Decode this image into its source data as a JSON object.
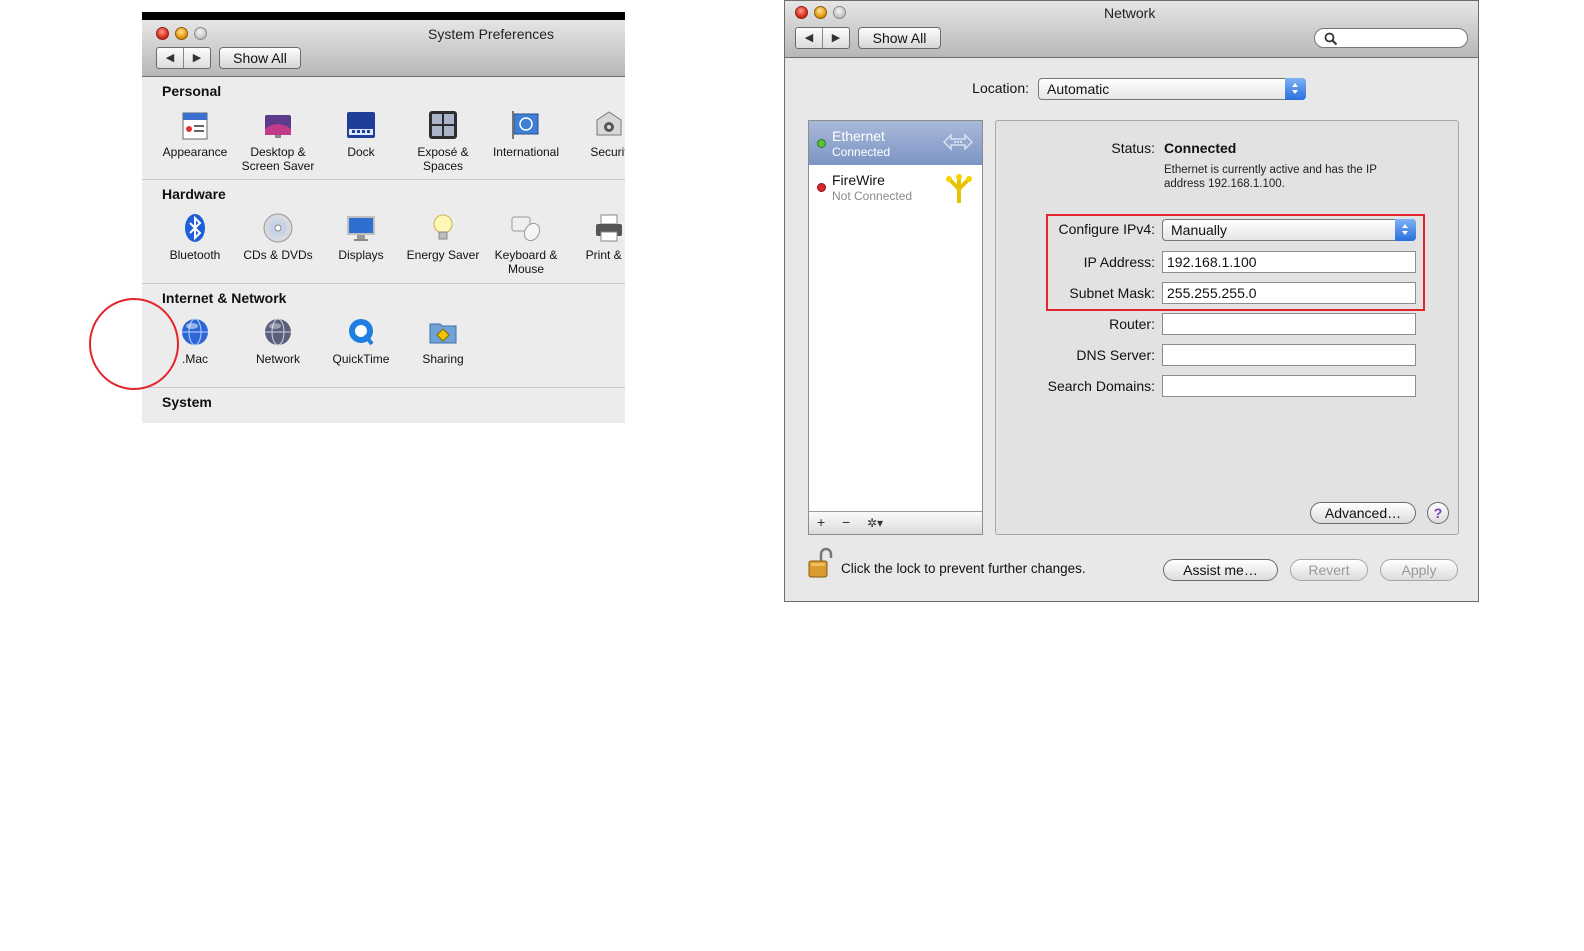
{
  "sysprefs": {
    "title": "System Preferences",
    "show_all": "Show All",
    "nav_back": "◀",
    "nav_forward": "▶",
    "sections": [
      {
        "title": "Personal",
        "items": [
          {
            "label": "Appearance",
            "icon": "appearance-icon"
          },
          {
            "label": "Desktop & Screen Saver",
            "icon": "desktop-icon"
          },
          {
            "label": "Dock",
            "icon": "dock-icon"
          },
          {
            "label": "Exposé & Spaces",
            "icon": "expose-icon"
          },
          {
            "label": "International",
            "icon": "international-icon"
          },
          {
            "label": "Securit",
            "icon": "security-icon"
          }
        ]
      },
      {
        "title": "Hardware",
        "items": [
          {
            "label": "Bluetooth",
            "icon": "bluetooth-icon"
          },
          {
            "label": "CDs & DVDs",
            "icon": "cd-icon"
          },
          {
            "label": "Displays",
            "icon": "display-icon"
          },
          {
            "label": "Energy Saver",
            "icon": "lightbulb-icon"
          },
          {
            "label": "Keyboard & Mouse",
            "icon": "keyboard-mouse-icon"
          },
          {
            "label": "Print & F",
            "icon": "printer-icon"
          }
        ]
      },
      {
        "title": "Internet & Network",
        "items": [
          {
            "label": ".Mac",
            "icon": "mac-globe-icon"
          },
          {
            "label": "Network",
            "icon": "network-globe-icon"
          },
          {
            "label": "QuickTime",
            "icon": "quicktime-icon"
          },
          {
            "label": "Sharing",
            "icon": "sharing-folder-icon"
          }
        ]
      },
      {
        "title": "System",
        "items": []
      }
    ]
  },
  "network": {
    "title": "Network",
    "show_all": "Show All",
    "nav_back": "◀",
    "nav_forward": "▶",
    "location_label": "Location:",
    "location_value": "Automatic",
    "services": [
      {
        "name": "Ethernet",
        "status": "Connected",
        "dot_color": "#5cc13a"
      },
      {
        "name": "FireWire",
        "status": "Not Connected",
        "dot_color": "#e0262a"
      }
    ],
    "sidebar_buttons": {
      "add": "+",
      "remove": "−",
      "action": "✲▾"
    },
    "status_label": "Status:",
    "status_value": "Connected",
    "status_desc": "Ethernet is currently active and has the IP address 192.168.1.100.",
    "configure_label": "Configure IPv4:",
    "configure_value": "Manually",
    "ip_label": "IP Address:",
    "ip_value": "192.168.1.100",
    "mask_label": "Subnet Mask:",
    "mask_value": "255.255.255.0",
    "router_label": "Router:",
    "router_value": "",
    "dns_label": "DNS Server:",
    "dns_value": "",
    "search_label": "Search Domains:",
    "search_value": "",
    "advanced": "Advanced…",
    "help": "?",
    "lock_text": "Click the lock to prevent further changes.",
    "assist": "Assist me…",
    "revert": "Revert",
    "apply": "Apply"
  },
  "colors": {
    "highlight_red": "#e3242b",
    "selection_blue": "#7d95c4"
  }
}
